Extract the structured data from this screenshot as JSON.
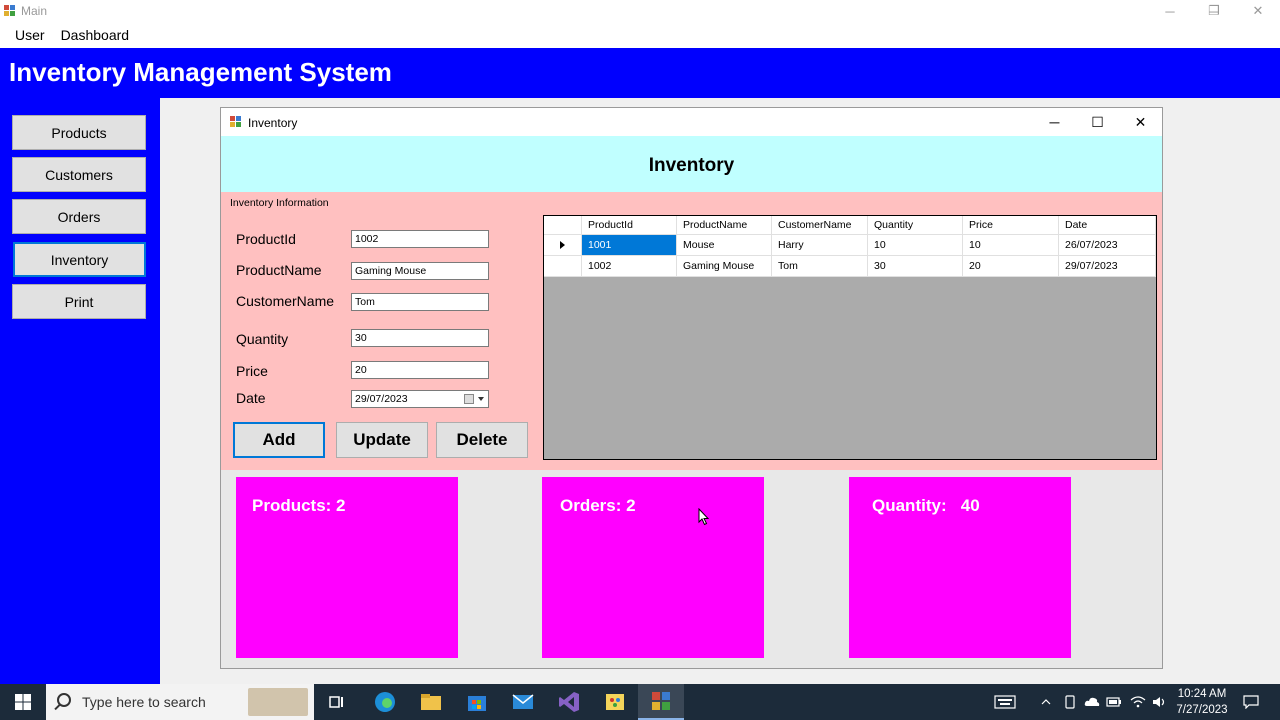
{
  "main_window": {
    "title": "Main",
    "controls": {
      "minimize": "─",
      "restore": "❐",
      "close": "✕"
    }
  },
  "menu": [
    "User",
    "Dashboard"
  ],
  "banner": {
    "title": "Inventory Management System"
  },
  "sidebar": {
    "items": [
      {
        "label": "Products"
      },
      {
        "label": "Customers"
      },
      {
        "label": "Orders"
      },
      {
        "label": "Inventory",
        "active": true
      },
      {
        "label": "Print"
      }
    ]
  },
  "inventory_window": {
    "title": "Inventory",
    "controls": {
      "minimize": "─",
      "maximize": "☐",
      "close": "✕"
    },
    "header": "Inventory",
    "group_label": "Inventory Information",
    "fields": {
      "product_id": {
        "label": "ProductId",
        "value": "1002"
      },
      "product_name": {
        "label": "ProductName",
        "value": "Gaming Mouse"
      },
      "customer_name": {
        "label": "CustomerName",
        "value": "Tom"
      },
      "quantity": {
        "label": "Quantity",
        "value": "30"
      },
      "price": {
        "label": "Price",
        "value": "20"
      },
      "date": {
        "label": "Date",
        "value": "29/07/2023"
      }
    },
    "buttons": {
      "add": "Add",
      "update": "Update",
      "delete": "Delete"
    },
    "grid": {
      "columns": [
        "ProductId",
        "ProductName",
        "CustomerName",
        "Quantity",
        "Price",
        "Date"
      ],
      "rows": [
        [
          "1001",
          "Mouse",
          "Harry",
          "10",
          "10",
          "26/07/2023"
        ],
        [
          "1002",
          "Gaming Mouse",
          "Tom",
          "30",
          "20",
          "29/07/2023"
        ]
      ]
    },
    "stats": {
      "products": "Products: 2",
      "orders": "Orders: 2",
      "quantity": "Quantity:   40"
    }
  },
  "taskbar": {
    "search_placeholder": "Type here to search",
    "time": "10:24 AM",
    "date": "7/27/2023"
  },
  "colors": {
    "banner": "#0000fe",
    "header_panel": "#c0ffff",
    "info_panel": "#ffc0c0",
    "stat_card": "#ff00ff",
    "selection": "#0078d7"
  }
}
